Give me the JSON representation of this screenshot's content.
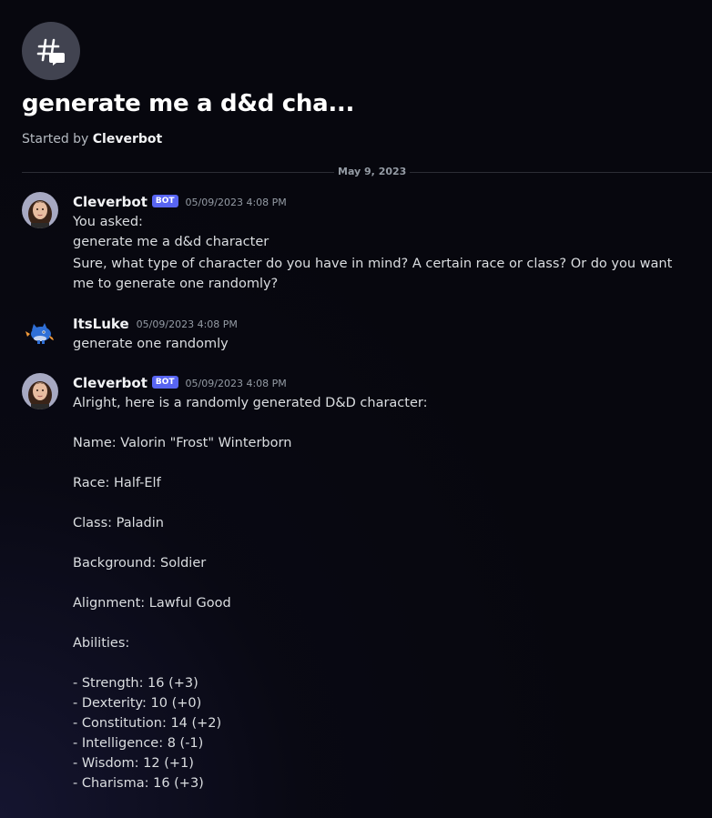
{
  "thread": {
    "title": "generate me a d&d cha...",
    "started_by_prefix": "Started by",
    "started_by_user": "Cleverbot"
  },
  "date_divider": "May 9, 2023",
  "messages": [
    {
      "author": "Cleverbot",
      "bot_tag": "BOT",
      "timestamp": "05/09/2023 4:08 PM",
      "lines": [
        "You asked:",
        "generate me a d&d character"
      ],
      "paragraph": "Sure, what type of character do you have in mind? A certain race or class? Or do you want me to generate one randomly?"
    },
    {
      "author": "ItsLuke",
      "timestamp": "05/09/2023 4:08 PM",
      "lines": [
        "generate one randomly"
      ]
    },
    {
      "author": "Cleverbot",
      "bot_tag": "BOT",
      "timestamp": "05/09/2023 4:08 PM",
      "intro": "Alright, here is a randomly generated D&D character:",
      "name": "Name: Valorin \"Frost\" Winterborn",
      "race": "Race: Half-Elf",
      "class": "Class: Paladin",
      "background": "Background: Soldier",
      "alignment": "Alignment: Lawful Good",
      "abilities_heading": "Abilities:",
      "abilities": [
        "- Strength: 16 (+3)",
        "- Dexterity: 10 (+0)",
        "- Constitution: 14 (+2)",
        "- Intelligence: 8 (-1)",
        "- Wisdom: 12 (+1)",
        "- Charisma: 16 (+3)"
      ]
    }
  ]
}
